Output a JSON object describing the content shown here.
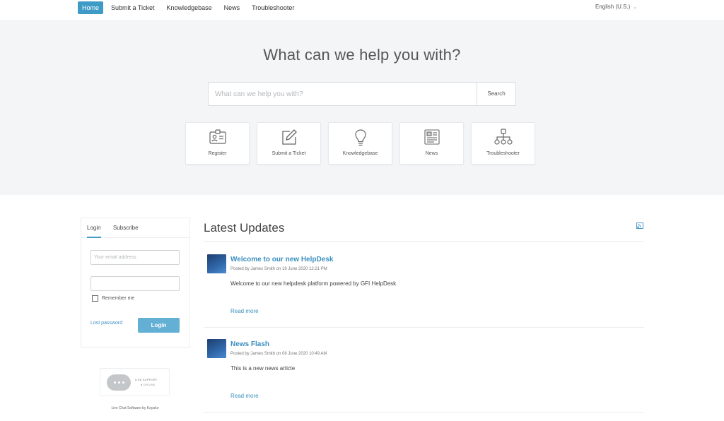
{
  "nav": {
    "items": [
      {
        "label": "Home",
        "active": true
      },
      {
        "label": "Submit a Ticket",
        "active": false
      },
      {
        "label": "Knowledgebase",
        "active": false
      },
      {
        "label": "News",
        "active": false
      },
      {
        "label": "Troubleshooter",
        "active": false
      }
    ],
    "language": "English (U.S.)"
  },
  "hero": {
    "title": "What can we help you with?",
    "search_placeholder": "What can we help you with?",
    "search_button": "Search",
    "tiles": [
      {
        "label": "Register",
        "icon": "id-card-icon"
      },
      {
        "label": "Submit a Ticket",
        "icon": "edit-icon"
      },
      {
        "label": "Knowledgebase",
        "icon": "lightbulb-icon"
      },
      {
        "label": "News",
        "icon": "newspaper-icon"
      },
      {
        "label": "Troubleshooter",
        "icon": "sitemap-icon"
      }
    ]
  },
  "login": {
    "tabs": [
      "Login",
      "Subscribe"
    ],
    "email_placeholder": "Your email address",
    "password_value": "",
    "remember_label": "Remember me",
    "lost_password": "Lost password",
    "button": "Login"
  },
  "live_support": {
    "title": "LIVE SUPPORT",
    "status": "● OFFLINE",
    "credit": "Live Chat Software by Kayako"
  },
  "updates": {
    "title": "Latest Updates",
    "articles": [
      {
        "title": "Welcome to our new HelpDesk",
        "meta": "Posted by James Smith on 19 June 2020 12:21 PM",
        "body": "Welcome to our new helpdesk platform powered by GFI HelpDesk",
        "read_more": "Read more"
      },
      {
        "title": "News Flash",
        "meta": "Posted by James Smith on 08 June 2020 10:49 AM",
        "body": "This is a new news article",
        "read_more": "Read more"
      }
    ]
  },
  "colors": {
    "accent": "#3d9bc6",
    "link": "#3a8fbf",
    "hero_bg": "#f4f5f6"
  }
}
